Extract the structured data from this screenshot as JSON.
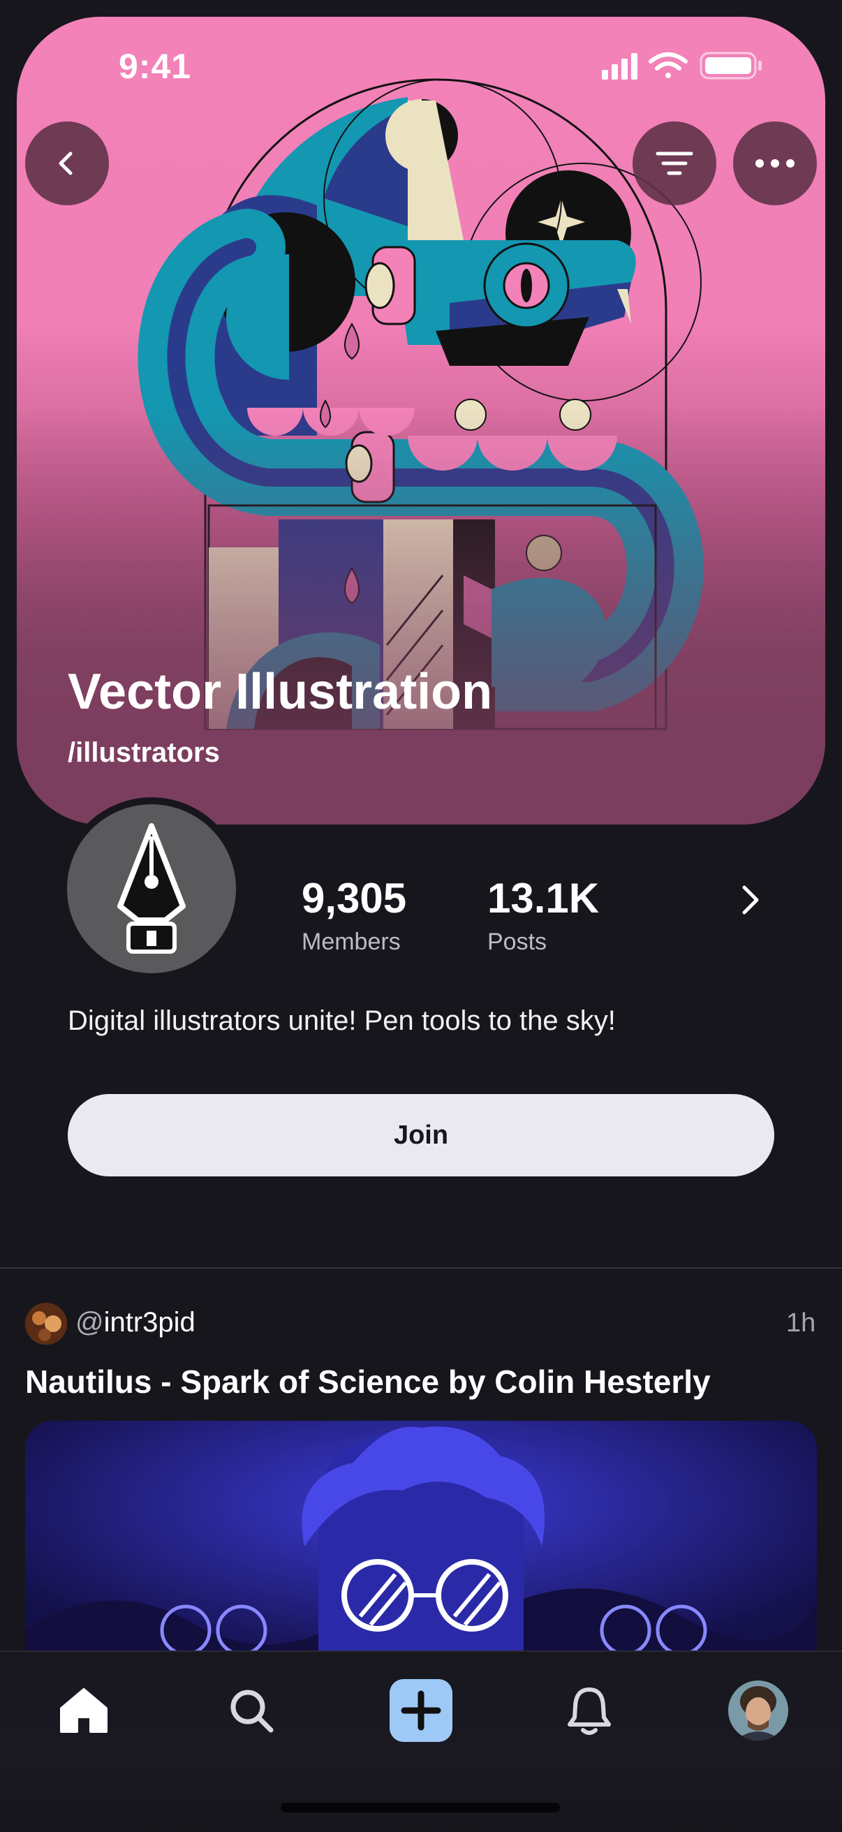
{
  "status_bar": {
    "time": "9:41"
  },
  "community": {
    "title": "Vector Illustration",
    "slug": "/illustrators",
    "description": "Digital illustrators unite! Pen tools to the sky!",
    "members_count": "9,305",
    "members_label": "Members",
    "posts_count": "13.1K",
    "posts_label": "Posts",
    "join_label": "Join"
  },
  "post": {
    "user_prefix": "@",
    "username": "intr3pid",
    "time": "1h",
    "title": "Nautilus - Spark of Science by Colin Hesterly"
  },
  "tab_bar": {
    "items": [
      "home-icon",
      "search-icon",
      "create-post-icon",
      "notifications-icon",
      "profile-avatar"
    ]
  },
  "colors": {
    "background": "#17161d",
    "hero_pink": "#f282b8",
    "join_button": "#eae9f0",
    "accent_blue": "#9ec9f7"
  }
}
